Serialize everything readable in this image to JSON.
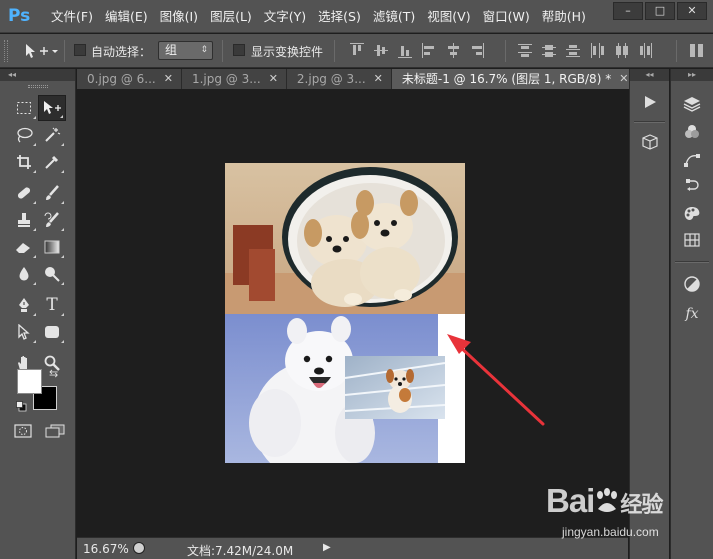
{
  "app": {
    "logo": "Ps",
    "accent_color": "#4fb3ff",
    "window_buttons": [
      "–",
      "□",
      "✕"
    ]
  },
  "menu": {
    "items": [
      "文件(F)",
      "编辑(E)",
      "图像(I)",
      "图层(L)",
      "文字(Y)",
      "选择(S)",
      "滤镜(T)",
      "视图(V)",
      "窗口(W)",
      "帮助(H)"
    ]
  },
  "options_bar": {
    "auto_select_label": "自动选择：",
    "auto_select_value": "组",
    "show_transform_label": "显示变换控件",
    "auto_select_checked": false,
    "show_transform_checked": false
  },
  "tabs": [
    {
      "label": "0.jpg @ 6...",
      "active": false
    },
    {
      "label": "1.jpg @ 3...",
      "active": false
    },
    {
      "label": "2.jpg @ 3...",
      "active": false
    },
    {
      "label": "未标题-1 @ 16.7% (图层 1, RGB/8) *",
      "active": true
    }
  ],
  "status": {
    "zoom": "16.67%",
    "doc_info": "文档:7.42M/24.0M"
  },
  "tools": {
    "foreground_color": "#ffffff",
    "background_color": "#000000"
  },
  "annotation": {
    "arrow_color": "#e8333a"
  },
  "watermark": {
    "brand": "Bai",
    "brand_suffix": "经验",
    "url": "jingyan.baidu.com"
  }
}
